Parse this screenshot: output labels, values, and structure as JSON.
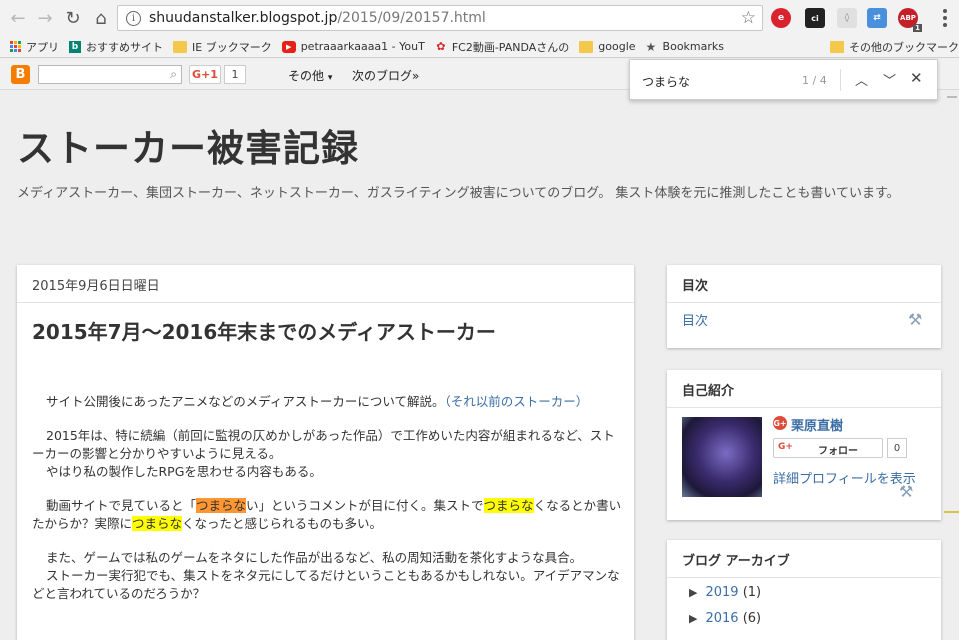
{
  "browser": {
    "url_host": "shuudanstalker.blogspot.jp",
    "url_path": "/2015/09/20157.html"
  },
  "extensions": {
    "ci_label": "ci",
    "abp_label": "ABP",
    "abp_badge": "1"
  },
  "bookmarks": [
    {
      "label": "アプリ"
    },
    {
      "label": "おすすめサイト"
    },
    {
      "label": "IE ブックマーク"
    },
    {
      "label": "petraaarkaaaa1 - YouT"
    },
    {
      "label": "FC2動画-PANDAさんの"
    },
    {
      "label": "google"
    },
    {
      "label": "Bookmarks"
    },
    {
      "label": "その他のブックマーク"
    }
  ],
  "blogger_nav": {
    "gplus_label": "G+1",
    "gplus_count": "1",
    "more_label": "その他",
    "next_blog_label": "次のブログ»"
  },
  "find": {
    "query": "つまらな",
    "count": "1 / 4"
  },
  "blog": {
    "title": "ストーカー被害記録",
    "description": "メディアストーカー、集団ストーカー、ネットストーカー、ガスライティング被害についてのブログ。 集スト体験を元に推測したことも書いています。"
  },
  "post": {
    "date": "2015年9月6日日曜日",
    "title": "2015年7月～2016年末までのメディアストーカー",
    "p1_text": "サイト公開後にあったアニメなどのメディアストーカーについて解説。",
    "p1_link": "（それ以前のストーカー）",
    "p2_line1": "2015年は、特に続編（前回に監視の仄めかしがあった作品）で工作めいた内容が組まれるなど、ストーカーの影響と分かりやすいように見える。",
    "p2_line2": "やはり私の製作したRPGを思わせる内容もある。",
    "p3_a": "動画サイトで見ていると「",
    "p3_hl1": "つまらな",
    "p3_b": "い」というコメントが目に付く。集ストで",
    "p3_hl2": "つまらな",
    "p3_c": "くなるとか書いたからか？実際に",
    "p3_hl3": "つまらな",
    "p3_d": "くなったと感じられるものも多い。",
    "p4_line1": "また、ゲームでは私のゲームをネタにした作品が出るなど、私の周知活動を茶化すような具合。",
    "p4_line2": "ストーカー実行犯でも、集ストをネタ元にしてるだけということもあるかもしれない。アイデアマンなどと言われているのだろうか？"
  },
  "sidebar": {
    "toc_title": "目次",
    "toc_link": "目次",
    "profile_title": "自己紹介",
    "profile_name": "栗原直樹",
    "follow_gp": "G+",
    "follow_label": "フォロー",
    "follow_count": "0",
    "profile_link": "詳細プロフィールを表示",
    "archive_title": "ブログ アーカイブ",
    "archive": [
      {
        "year": "2019",
        "count": "(1)"
      },
      {
        "year": "2016",
        "count": "(6)"
      }
    ]
  }
}
